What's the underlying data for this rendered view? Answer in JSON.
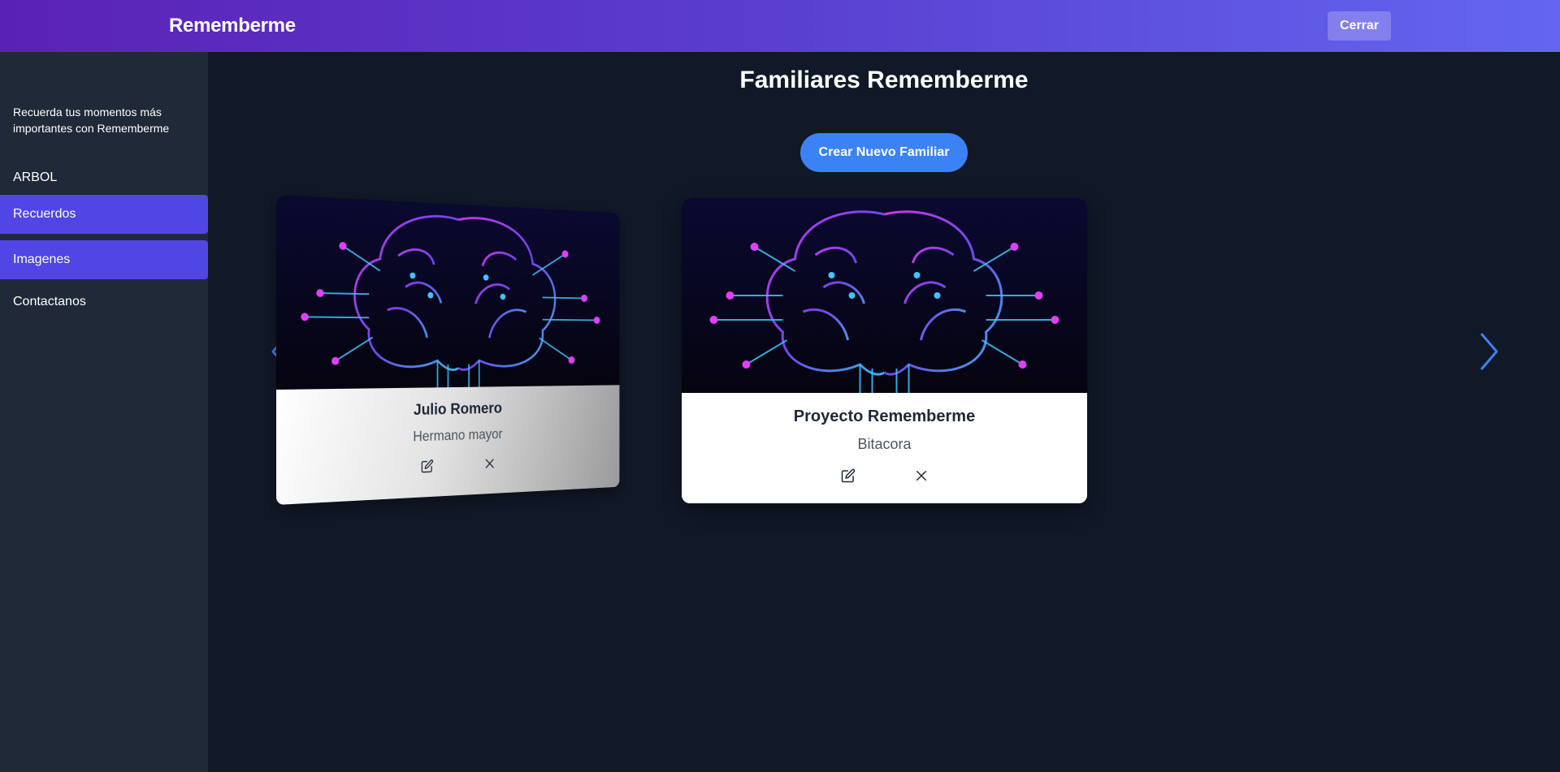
{
  "header": {
    "brand": "Rememberme",
    "close_label": "Cerrar"
  },
  "sidebar": {
    "tagline": "Recuerda tus momentos más importantes con Rememberme",
    "heading": "ARBOL",
    "items": [
      {
        "label": "Recuerdos",
        "active": true
      },
      {
        "label": "Imagenes",
        "active": true
      },
      {
        "label": "Contactanos",
        "active": false
      }
    ]
  },
  "main": {
    "title": "Familiares Rememberme",
    "create_label": "Crear Nuevo Familiar",
    "cards": [
      {
        "name": "Julio Romero",
        "relation": "Hermano mayor",
        "image": "circuit-brain"
      },
      {
        "name": "Proyecto Rememberme",
        "relation": "Bitacora",
        "image": "circuit-brain"
      }
    ]
  },
  "colors": {
    "header_gradient": [
      "#5b21b6",
      "#6366f1"
    ],
    "sidebar_bg": "#1f2937",
    "main_bg": "#111827",
    "active_nav": "#4f46e5",
    "primary_button": "#3b82f6",
    "arrow": "#3b82f6"
  },
  "icons": [
    "edit-icon",
    "close-icon",
    "chevron-left-icon",
    "chevron-right-icon"
  ]
}
